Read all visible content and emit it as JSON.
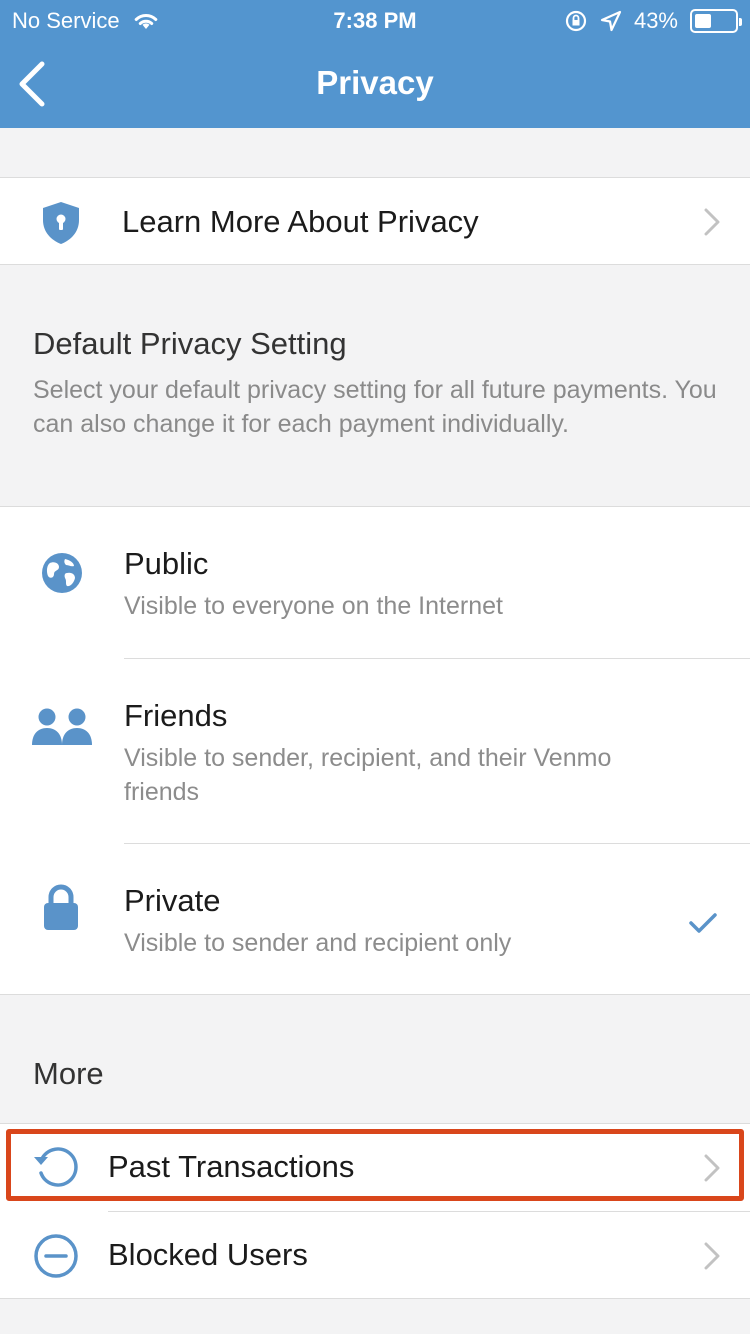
{
  "status_bar": {
    "carrier": "No Service",
    "time": "7:38 PM",
    "battery_percent": "43%",
    "battery_level": 0.43
  },
  "nav": {
    "title": "Privacy"
  },
  "learn_more": {
    "label": "Learn More About Privacy"
  },
  "default_privacy": {
    "title": "Default Privacy Setting",
    "description": "Select your default privacy setting for all future payments. You can also change it for each payment individually.",
    "options": [
      {
        "label": "Public",
        "description": "Visible to everyone on the Internet",
        "selected": false,
        "icon": "globe-icon"
      },
      {
        "label": "Friends",
        "description": "Visible to sender, recipient, and their Venmo friends",
        "selected": false,
        "icon": "friends-icon"
      },
      {
        "label": "Private",
        "description": "Visible to sender and recipient only",
        "selected": true,
        "icon": "lock-icon"
      }
    ]
  },
  "more": {
    "title": "More",
    "items": [
      {
        "label": "Past Transactions",
        "icon": "history-icon"
      },
      {
        "label": "Blocked Users",
        "icon": "blocked-icon"
      }
    ]
  },
  "colors": {
    "header": "#5395cf",
    "accent": "#5a93c9",
    "highlight": "#d9461b"
  }
}
